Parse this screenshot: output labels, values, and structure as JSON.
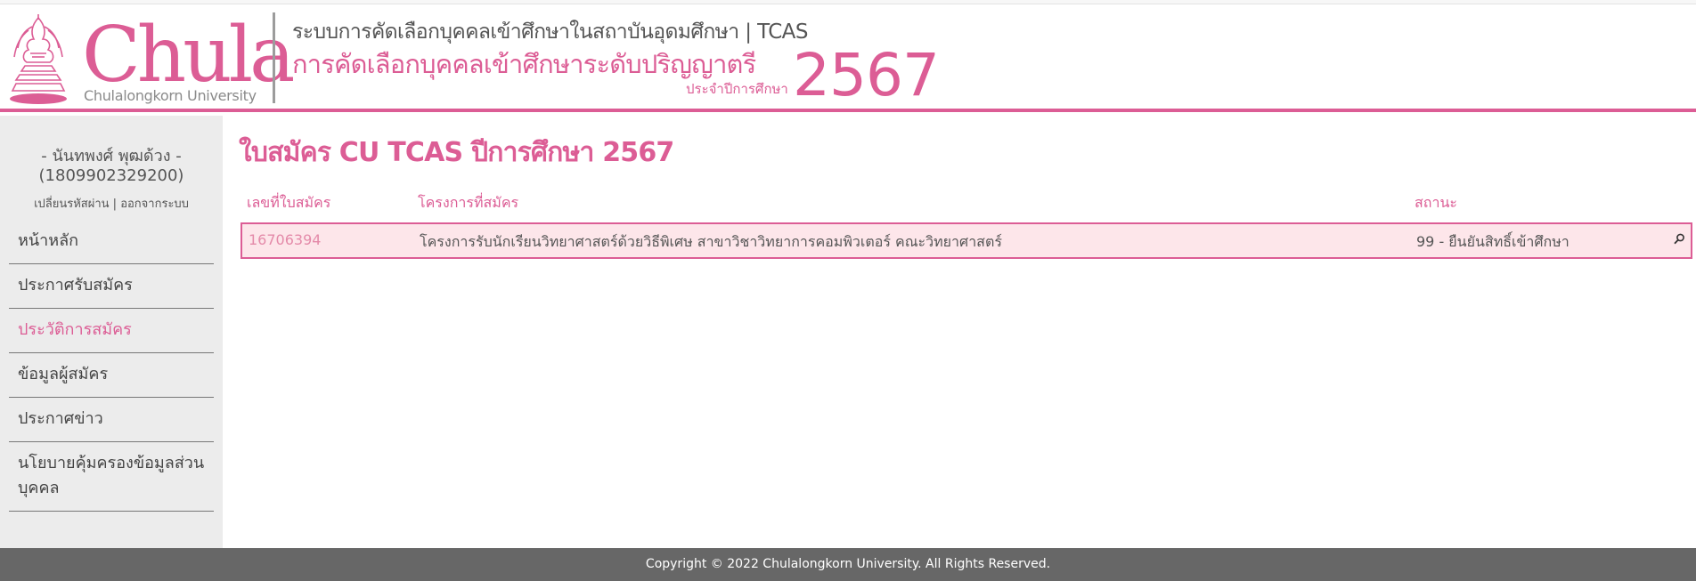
{
  "header": {
    "logo_word": "Chula",
    "logo_sub": "Chulalongkorn University",
    "line1": "ระบบการคัดเลือกบุคคลเข้าศึกษาในสถาบันอุดมศึกษา | TCAS",
    "line2": "การคัดเลือกบุคคลเข้าศึกษาระดับปริญญาตรี",
    "sub": "ประจำปีการศึกษา",
    "year": "2567"
  },
  "user": {
    "name": "- นันทพงศ์ พุฒด้วง -",
    "id": "(1809902329200)",
    "change_password": "เปลี่ยนรหัสผ่าน",
    "separator": " | ",
    "logout": "ออกจากระบบ"
  },
  "sidebar": {
    "items": [
      {
        "label": "หน้าหลัก"
      },
      {
        "label": "ประกาศรับสมัคร"
      },
      {
        "label": "ประวัติการสมัคร"
      },
      {
        "label": "ข้อมูลผู้สมัคร"
      },
      {
        "label": "ประกาศข่าว"
      },
      {
        "label": "นโยบายคุ้มครองข้อมูลส่วนบุคคล"
      }
    ],
    "active_index": 2
  },
  "main": {
    "title": "ใบสมัคร CU TCAS ปีการศึกษา 2567",
    "columns": [
      "เลขที่ใบสมัคร",
      "โครงการที่สมัคร",
      "สถานะ"
    ],
    "rows": [
      {
        "app_no": "16706394",
        "program": "โครงการรับนักเรียนวิทยาศาสตร์ด้วยวิธีพิเศษ สาขาวิชาวิทยาการคอมพิวเตอร์ คณะวิทยาศาสตร์",
        "status": "99 - ยืนยันสิทธิ์เข้าศึกษา"
      }
    ]
  },
  "footer": {
    "text": "Copyright © 2022 Chulalongkorn University. All Rights Reserved."
  },
  "colors": {
    "accent": "#dc5d95",
    "row_bg": "#fde6ea",
    "sidebar_bg": "#ececec",
    "footer_bg": "#676767"
  },
  "icons": {
    "logo": "phra-kiao-seal-icon",
    "view": "magnifier-icon"
  }
}
